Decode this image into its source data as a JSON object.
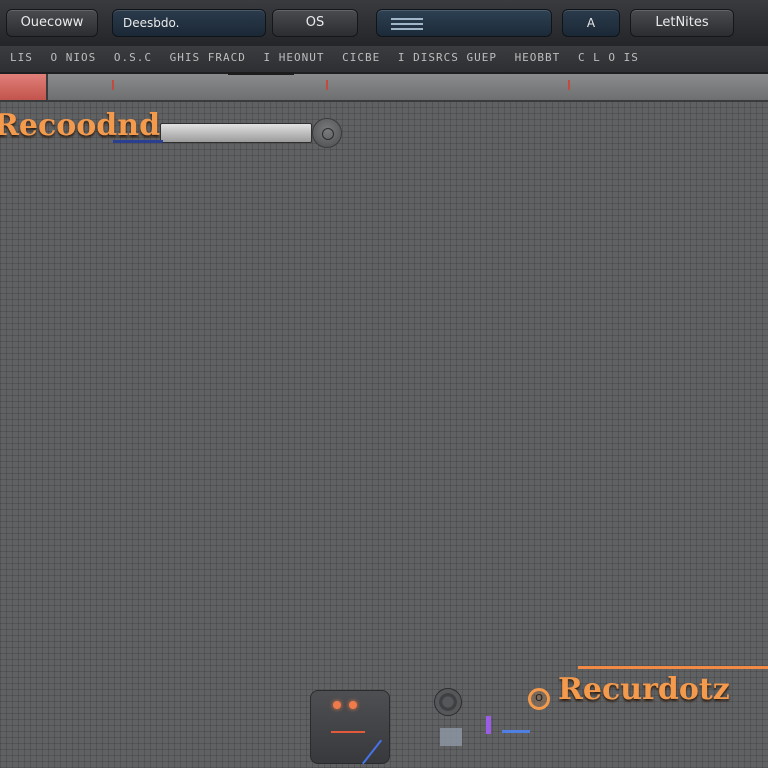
{
  "toolbar": {
    "button1": "Ouecoww",
    "field": "Deesbdo.",
    "button_os": "OS",
    "button_a": "A",
    "button_notes": "LetNites"
  },
  "ruler": {
    "segments": [
      "LIS",
      "O NIOS",
      "O.S.C",
      "GHIS FRACD",
      "I HEONUT",
      "CICBE",
      "I DISRCS GUEP",
      "HEOBBT",
      "C L O IS"
    ]
  },
  "record_panel": {
    "title": "Recoodnd"
  },
  "bottom": {
    "title": "Recurdotz",
    "o_label": "O"
  },
  "colors": {
    "accent_orange": "#f39a4d",
    "track_red": "#c2544c",
    "background": "#5f6062"
  }
}
